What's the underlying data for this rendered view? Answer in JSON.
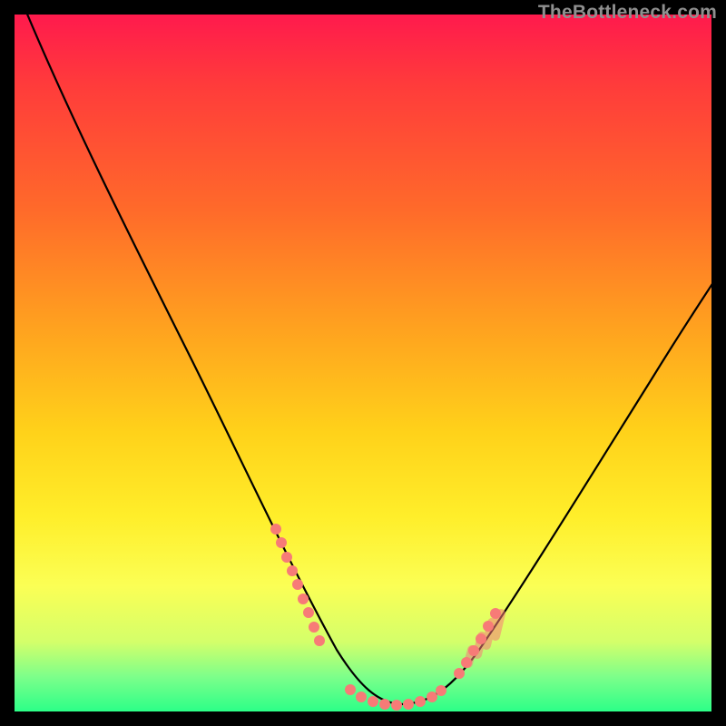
{
  "watermark": "TheBottleneck.com",
  "colors": {
    "background": "#000000",
    "curve": "#000000",
    "marker": "#f77b77",
    "gradient_top": "#ff1a4d",
    "gradient_bottom": "#2cff88"
  },
  "chart_data": {
    "type": "line",
    "title": "",
    "xlabel": "",
    "ylabel": "",
    "xlim": [
      0,
      100
    ],
    "ylim": [
      0,
      100
    ],
    "grid": false,
    "legend": false,
    "description": "Asymmetric V-shaped bottleneck curve over a vertical red-to-green gradient; minimum near x≈55; left branch steeper than right; salmon dot clusters along left descent (x≈36–42), flat bottom (x≈47–62), and right ascent (x≈63–68); right branch continues off-screen near y≈62 at x=100.",
    "series": [
      {
        "name": "bottleneck-curve",
        "x": [
          0,
          5,
          10,
          15,
          20,
          25,
          30,
          35,
          40,
          45,
          50,
          55,
          60,
          65,
          70,
          75,
          80,
          85,
          90,
          95,
          100
        ],
        "y": [
          100,
          91,
          82,
          72,
          62,
          52,
          42,
          32,
          21,
          10,
          3,
          1,
          3,
          9,
          17,
          25,
          33,
          41,
          48,
          55,
          62
        ]
      }
    ],
    "highlight_clusters": [
      {
        "name": "left-descent",
        "x_range": [
          36,
          42
        ],
        "y_range": [
          18,
          32
        ]
      },
      {
        "name": "valley-bottom",
        "x_range": [
          47,
          62
        ],
        "y_range": [
          1,
          4
        ]
      },
      {
        "name": "right-ascent",
        "x_range": [
          63,
          68
        ],
        "y_range": [
          6,
          15
        ]
      }
    ]
  }
}
